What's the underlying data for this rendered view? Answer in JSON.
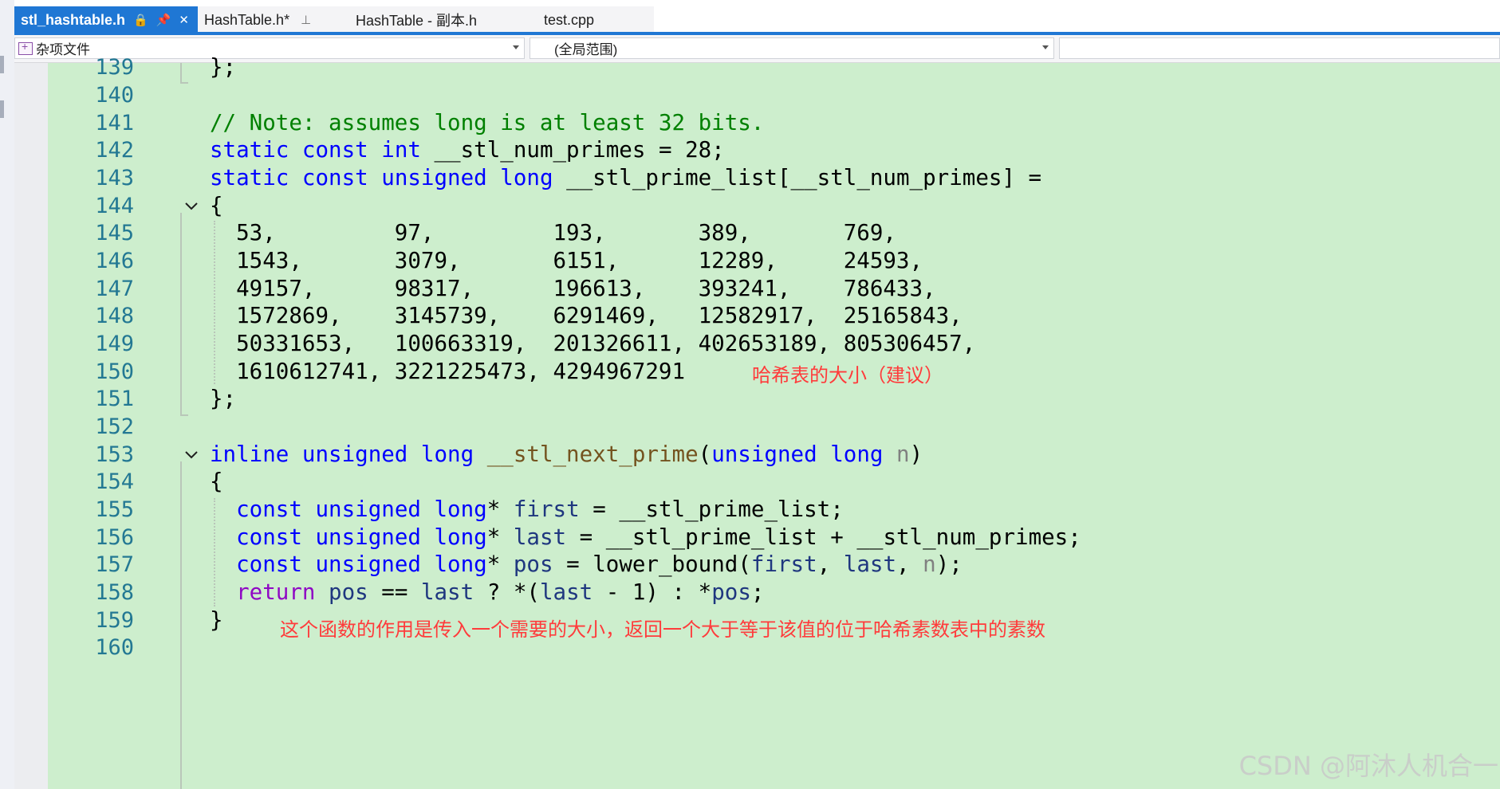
{
  "tabs": [
    {
      "name": "stl_hashtable.h",
      "icons": [
        "lock-icon",
        "pin-icon",
        "close-icon"
      ]
    },
    {
      "name": "HashTable.h*",
      "icons": [
        "pin-icon"
      ]
    },
    {
      "name": "HashTable - 副本.h",
      "icons": []
    },
    {
      "name": "test.cpp",
      "icons": []
    }
  ],
  "navbar": {
    "project": "杂项文件",
    "scope": "(全局范围)",
    "member": ""
  },
  "line_numbers": [
    "139",
    "140",
    "141",
    "142",
    "143",
    "144",
    "145",
    "146",
    "147",
    "148",
    "149",
    "150",
    "151",
    "152",
    "153",
    "154",
    "155",
    "156",
    "157",
    "158",
    "159",
    "160"
  ],
  "code": {
    "l139": "};",
    "l141": "// Note: assumes long is at least 32 bits.",
    "l142": {
      "k1": "static",
      "k2": "const",
      "k3": "int",
      "rest": " __stl_num_primes = 28;"
    },
    "l143": {
      "k1": "static",
      "k2": "const",
      "k3": "unsigned",
      "k4": "long",
      "rest": " __stl_prime_list[__stl_num_primes] ="
    },
    "l144": "{",
    "l145": "  53,         97,         193,       389,       769,",
    "l146": "  1543,       3079,       6151,      12289,     24593,",
    "l147": "  49157,      98317,      196613,    393241,    786433,",
    "l148": "  1572869,    3145739,    6291469,   12582917,  25165843,",
    "l149": "  50331653,   100663319,  201326611, 402653189, 805306457,",
    "l150": "  1610612741, 3221225473, 4294967291",
    "l151": "};",
    "l153": {
      "k1": "inline",
      "k2": "unsigned",
      "k3": "long",
      "fn": "__stl_next_prime",
      "k4": "unsigned",
      "k5": "long",
      "param": "n"
    },
    "l154": "{",
    "l155": {
      "k1": "const",
      "k2": "unsigned",
      "k3": "long",
      "var": "first",
      "rest": " = __stl_prime_list;"
    },
    "l156": {
      "k1": "const",
      "k2": "unsigned",
      "k3": "long",
      "var": "last",
      "rest": " = __stl_prime_list + __stl_num_primes;"
    },
    "l157": {
      "k1": "const",
      "k2": "unsigned",
      "k3": "long",
      "var": "pos",
      "rest1": " = lower_bound(",
      "a1": "first",
      "a2": "last",
      "a3": "n"
    },
    "l158": {
      "ret": "return",
      "v1": "pos",
      "v2": "last",
      "v3": "last",
      "v4": "pos"
    },
    "l159": "}"
  },
  "annotations": {
    "a1": "哈希表的大小（建议）",
    "a2": "这个函数的作用是传入一个需要的大小，返回一个大于等于该值的位于哈希素数表中的素数"
  },
  "watermark": "CSDN @阿沐人机合一",
  "colors": {
    "tab_active": "#1f77d4",
    "code_background": "#cdeecd",
    "keyword": "#0000ff",
    "comment": "#008000",
    "annotation": "#ff3b3b"
  }
}
